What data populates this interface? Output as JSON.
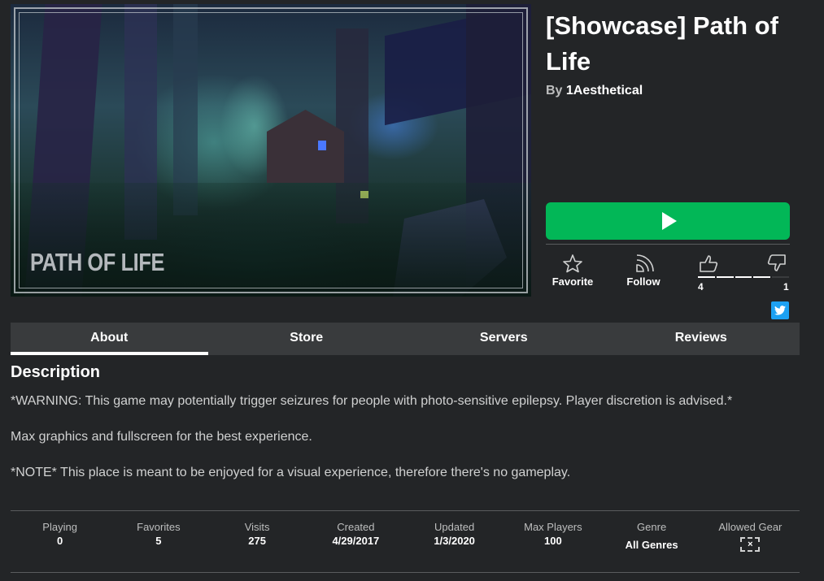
{
  "game": {
    "title": "[Showcase] Path of Life",
    "by_prefix": "By",
    "creator": "1Aesthetical",
    "thumbnail_text": "PATH OF LIFE"
  },
  "actions": {
    "play_icon": "play-icon",
    "favorite_label": "Favorite",
    "follow_label": "Follow",
    "upvotes": "4",
    "downvotes": "1",
    "upvote_fraction": 0.8,
    "share": "twitter-icon"
  },
  "colors": {
    "play_button": "#02b757",
    "background": "#232527",
    "tab_bar": "#393b3d",
    "twitter": "#1da1f2"
  },
  "tabs": [
    {
      "label": "About",
      "active": true
    },
    {
      "label": "Store",
      "active": false
    },
    {
      "label": "Servers",
      "active": false
    },
    {
      "label": "Reviews",
      "active": false
    }
  ],
  "description": {
    "heading": "Description",
    "paragraphs": [
      "*WARNING: This game may potentially trigger seizures for people with photo-sensitive epilepsy. Player discretion is advised.*",
      "Max graphics and fullscreen for the best experience.",
      "*NOTE* This place is meant to be enjoyed for a visual experience, therefore there's no gameplay."
    ]
  },
  "stats": [
    {
      "label": "Playing",
      "value": "0"
    },
    {
      "label": "Favorites",
      "value": "5"
    },
    {
      "label": "Visits",
      "value": "275"
    },
    {
      "label": "Created",
      "value": "4/29/2017"
    },
    {
      "label": "Updated",
      "value": "1/3/2020"
    },
    {
      "label": "Max Players",
      "value": "100"
    },
    {
      "label": "Genre",
      "value": "All Genres"
    },
    {
      "label": "Allowed Gear",
      "value": "×"
    }
  ]
}
